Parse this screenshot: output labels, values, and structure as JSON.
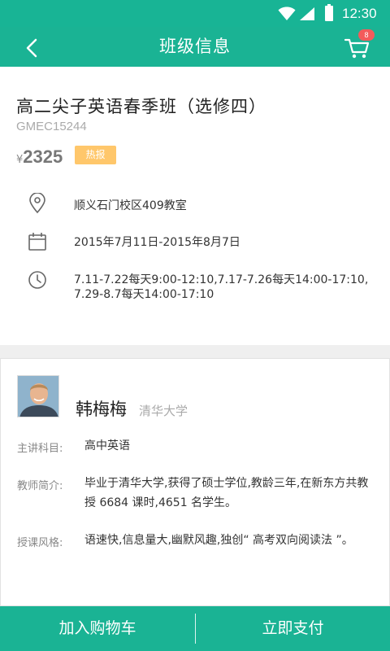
{
  "status_bar": {
    "time": "12:30"
  },
  "app_bar": {
    "title": "班级信息",
    "cart_count": "8"
  },
  "course": {
    "name": "高二尖子英语春季班（选修四）",
    "code": "GMEC15244",
    "currency_symbol": "¥",
    "price": "2325",
    "hot_label": "热报",
    "location": "顺义石门校区409教室",
    "date_range": "2015年7月11日-2015年8月7日",
    "schedule": "7.11-7.22每天9:00-12:10,7.17-7.26每天14:00-17:10, 7.29-8.7每天14:00-17:10"
  },
  "teacher": {
    "name": "韩梅梅",
    "school": "清华大学",
    "subject_label": "主讲科目:",
    "subject": "高中英语",
    "intro_label": "教师简介:",
    "intro": "毕业于清华大学,获得了硕士学位,教龄三年,在新东方共教授 6684 课时,4651 名学生。",
    "style_label": "授课风格:",
    "style": "语速快,信息量大,幽默风趣,独创“ 高考双向阅读法 ”。"
  },
  "bottom_bar": {
    "add_to_cart": "加入购物车",
    "pay_now": "立即支付"
  },
  "colors": {
    "primary": "#1ab394",
    "badge": "#f35b5b",
    "hot": "#ffc76b"
  },
  "icons": [
    "back-arrow-icon",
    "cart-icon",
    "location-pin-icon",
    "calendar-icon",
    "clock-icon",
    "wifi-icon",
    "signal-icon",
    "battery-icon"
  ]
}
